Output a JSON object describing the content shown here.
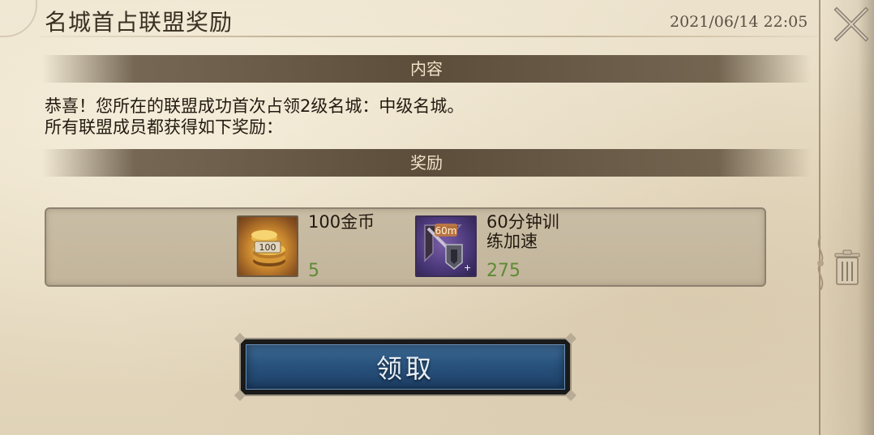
{
  "header": {
    "title": "名城首占联盟奖励",
    "timestamp": "2021/06/14 22:05",
    "close_icon": "close-x-icon"
  },
  "sections": {
    "content_label": "内容",
    "reward_label": "奖励"
  },
  "message": {
    "line1": "恭喜！您所在的联盟成功首次占领2级名城：中级名城。",
    "line2": "所有联盟成员都获得如下奖励："
  },
  "rewards": [
    {
      "icon": "gold-coins-icon",
      "badge": "100",
      "name": "100金币",
      "count": "5"
    },
    {
      "icon": "training-speedup-icon",
      "badge": "60m",
      "name": "60分钟训练加速",
      "count": "275"
    }
  ],
  "actions": {
    "claim_label": "领取",
    "trash_icon": "trash-icon"
  },
  "colors": {
    "parchment": "#e8dcc4",
    "section_bar": "#5c4d3b",
    "count_green": "#5f8a35",
    "button_blue": "#28527c"
  }
}
